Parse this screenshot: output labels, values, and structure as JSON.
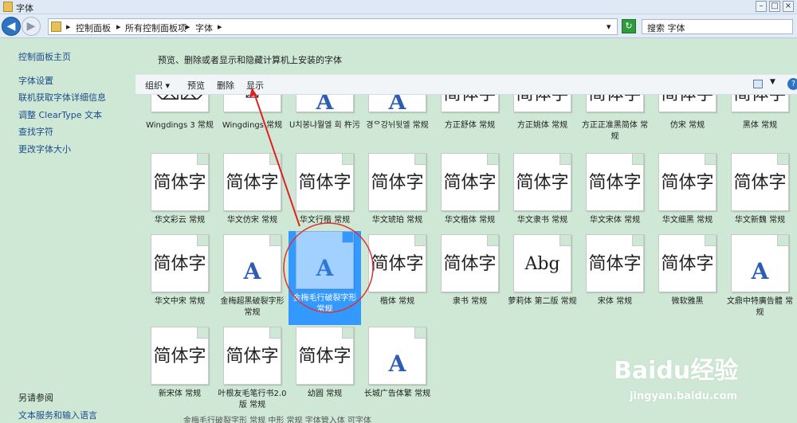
{
  "window": {
    "title": "字体",
    "min": "–",
    "max": "□",
    "close": "×"
  },
  "address": {
    "crumbs": [
      "控制面板",
      "所有控制面板项",
      "字体"
    ],
    "sep": "▸",
    "refresh_icon": "refresh-icon",
    "search_value": "搜索 字体"
  },
  "sidebar": {
    "links": [
      "控制面板主页",
      "字体设置",
      "联机获取字体详细信息",
      "调整 ClearType 文本",
      "查找字符",
      "更改字体大小"
    ],
    "see_also_heading": "另请参阅",
    "see_also_links": [
      "文本服务和输入语言"
    ]
  },
  "main": {
    "description": "预览、删除或者显示和隐藏计算机上安装的字体"
  },
  "toolbar": {
    "organize": "组织 ▾",
    "preview": "预览",
    "delete": "删除",
    "show": "显示",
    "help": "?"
  },
  "fonts_row1": [
    {
      "label": "Wingdings 3 常规",
      "sample": "⌫⌦"
    },
    {
      "label": "Wingdings 常规",
      "sample": "✉"
    },
    {
      "label": "ᑌ치봉냐뭘엘 회 杵污",
      "sample": "A"
    },
    {
      "label": "경ᄋ강뉘뒷엘 常规",
      "sample": "A"
    },
    {
      "label": "方正舒体 常规",
      "sample": "简体字"
    },
    {
      "label": "方正姚体 常规",
      "sample": "简体字"
    },
    {
      "label": "方正正准黑简体 常规",
      "sample": "简体字"
    },
    {
      "label": "仿宋 常规",
      "sample": "简体字"
    },
    {
      "label": "黑体 常规",
      "sample": "简体字"
    }
  ],
  "fonts_row2": [
    {
      "label": "华文彩云 常规",
      "sample": "简体字"
    },
    {
      "label": "华文仿宋 常规",
      "sample": "简体字"
    },
    {
      "label": "华文行楷 常规",
      "sample": "简体字"
    },
    {
      "label": "华文琥珀 常规",
      "sample": "简体字"
    },
    {
      "label": "华文楷体 常规",
      "sample": "简体字"
    },
    {
      "label": "华文隶书 常规",
      "sample": "简体字"
    },
    {
      "label": "华文宋体 常规",
      "sample": "简体字"
    },
    {
      "label": "华文细黑 常规",
      "sample": "简体字"
    },
    {
      "label": "华文新魏 常规",
      "sample": "简体字"
    }
  ],
  "fonts_row3": [
    {
      "label": "华文中宋 常规",
      "sample": "简体字"
    },
    {
      "label": "金梅超黑破裂字形 常规",
      "sample": "A"
    },
    {
      "label": "金梅毛行破裂字形 常规",
      "sample": "A"
    },
    {
      "label": "楷体 常规",
      "sample": "简体字"
    },
    {
      "label": "隶书 常规",
      "sample": "简体字"
    },
    {
      "label": "萝莉体 第二版 常规",
      "sample": "Abg"
    },
    {
      "label": "宋体 常规",
      "sample": "简体字"
    },
    {
      "label": "微软雅黑",
      "sample": "简体字"
    },
    {
      "label": "文鼎中特廣告體 常规",
      "sample": "A"
    }
  ],
  "fonts_row4": [
    {
      "label": "新宋体 常规",
      "sample": "简体字"
    },
    {
      "label": "叶根友毛笔行书2.0版 常规",
      "sample": "简体字"
    },
    {
      "label": "幼圆 常规",
      "sample": "简体字"
    },
    {
      "label": "长城广告体繁 常规",
      "sample": "A"
    }
  ],
  "bottom_strip": "金梅毛行破裂字形 常规    中形 常规         字体管入体   可字体",
  "watermark": {
    "brand": "Baidu经验",
    "url": "jingyan.baidu.com"
  }
}
